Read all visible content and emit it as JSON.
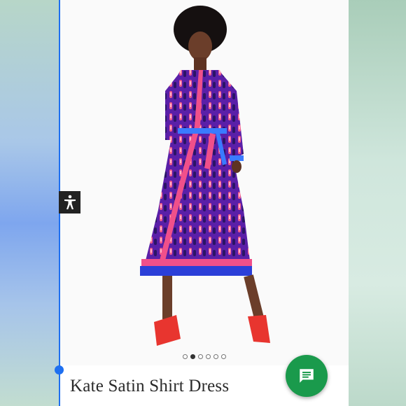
{
  "product": {
    "title": "Kate Satin Shirt Dress",
    "image_alt": "model-wearing-purple-print-shirt-dress"
  },
  "carousel": {
    "total": 6,
    "active": 2
  },
  "icons": {
    "accessibility": "accessibility-icon",
    "chat": "chat-icon"
  },
  "colors": {
    "chat_button": "#1a9a4c",
    "accent_blue": "#1e6ff0",
    "dress_purple": "#6a2bb0",
    "shoe_red": "#e8352f"
  }
}
